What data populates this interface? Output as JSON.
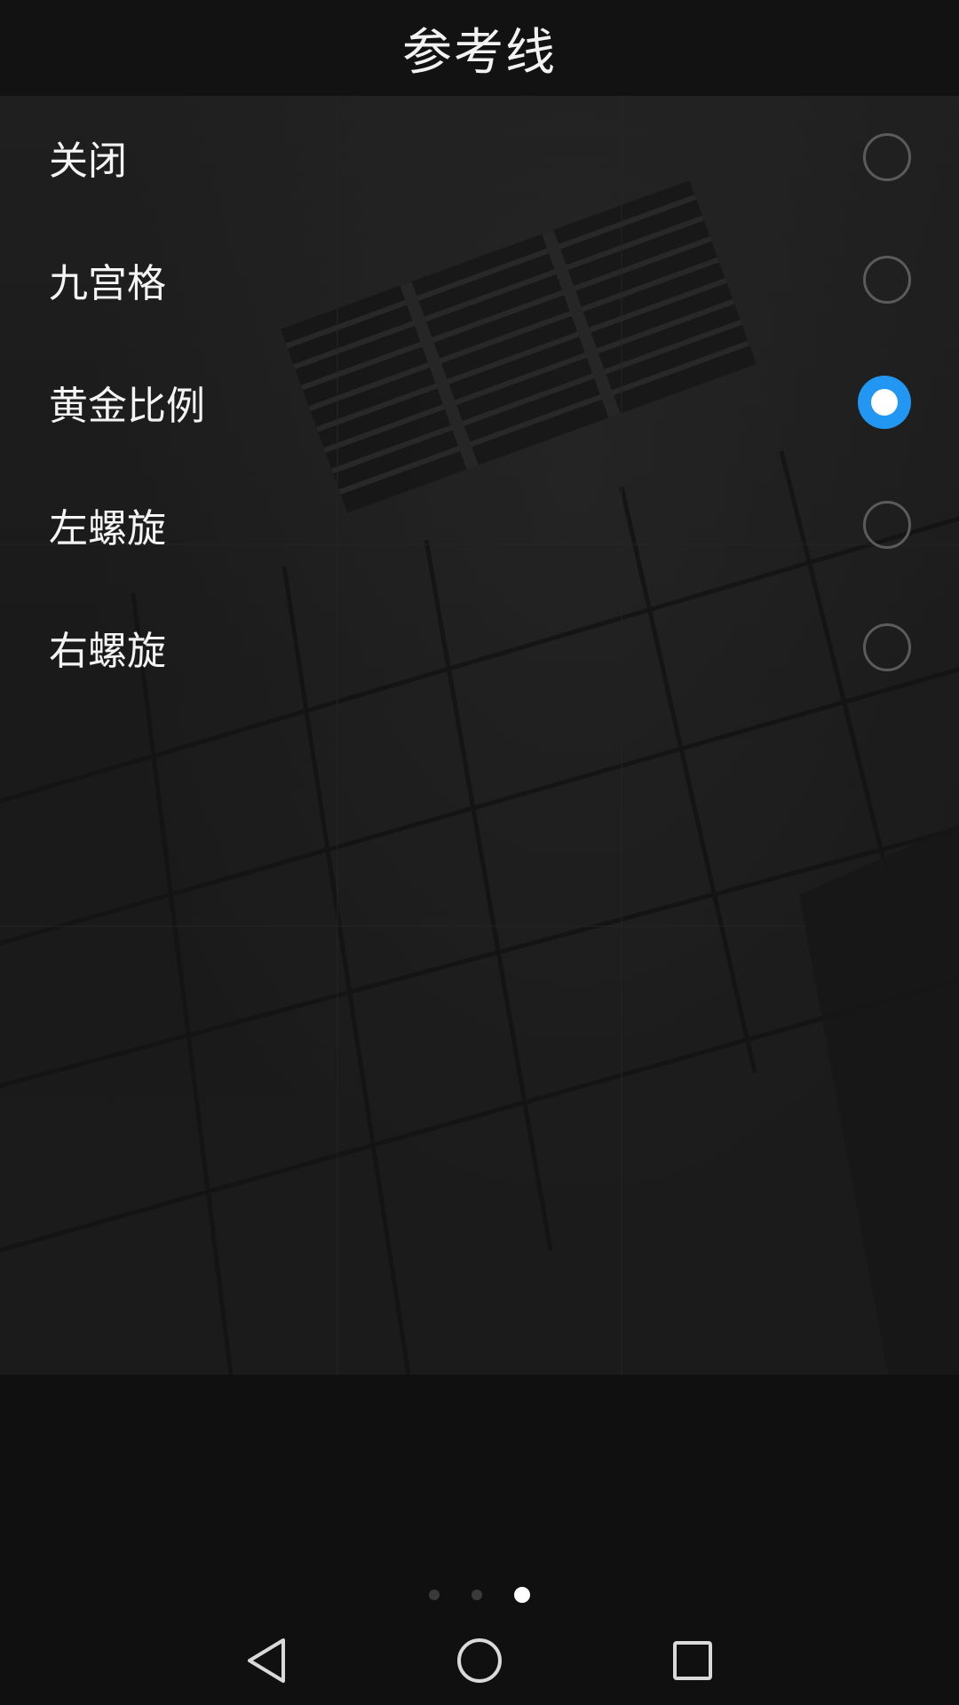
{
  "header": {
    "title": "参考线"
  },
  "options": [
    {
      "label": "关闭",
      "selected": false
    },
    {
      "label": "九宫格",
      "selected": false
    },
    {
      "label": "黄金比例",
      "selected": true
    },
    {
      "label": "左螺旋",
      "selected": false
    },
    {
      "label": "右螺旋",
      "selected": false
    }
  ],
  "pager": {
    "total": 3,
    "current": 3
  },
  "colors": {
    "accent": "#2196f3",
    "background": "#111111",
    "text": "#f4f4f4"
  },
  "nav": {
    "back_icon": "back-icon",
    "home_icon": "home-icon",
    "recents_icon": "recents-icon"
  }
}
